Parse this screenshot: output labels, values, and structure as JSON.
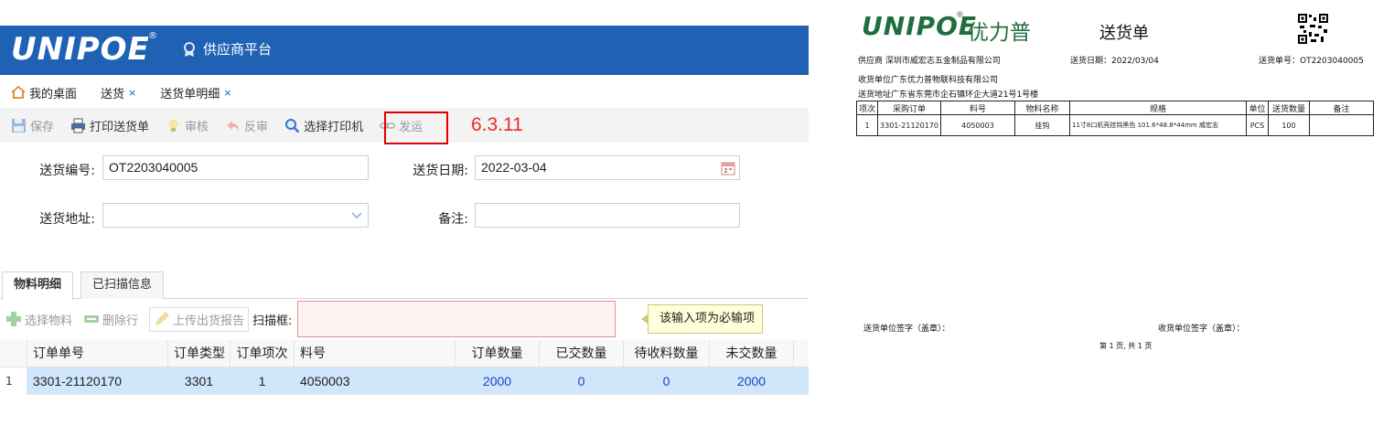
{
  "app": {
    "logo_text": "UNIPOE",
    "logo_reg": "®",
    "platform_name": "供应商平台",
    "tabs": [
      {
        "label": "我的桌面",
        "closable": false
      },
      {
        "label": "送货",
        "closable": true
      },
      {
        "label": "送货单明细",
        "closable": true
      }
    ],
    "tab_close": "×",
    "toolbar": {
      "save": "保存",
      "print": "打印送货单",
      "audit": "审核",
      "unaudit": "反审",
      "select_printer": "选择打印机",
      "send": "发运"
    },
    "version_annotation": "6.3.11",
    "form": {
      "delivery_no_label": "送货编号:",
      "delivery_no_value": "OT2203040005",
      "delivery_date_label": "送货日期:",
      "delivery_date_value": "2022-03-04",
      "address_label": "送货地址:",
      "address_value": "",
      "remark_label": "备注:",
      "remark_value": ""
    },
    "subtabs": {
      "materials": "物料明细",
      "scanned": "已扫描信息"
    },
    "subtoolbar": {
      "select_material": "选择物料",
      "delete_row": "删除行",
      "upload_report": "上传出货报告",
      "scan_label": "扫描框:",
      "required_tip": "该输入项为必输项"
    },
    "grid": {
      "columns": [
        "订单单号",
        "订单类型",
        "订单项次",
        "料号",
        "订单数量",
        "已交数量",
        "待收料数量",
        "未交数量"
      ],
      "rows": [
        {
          "index": "1",
          "cells": [
            "3301-21120170",
            "3301",
            "1",
            "4050003",
            "2000",
            "0",
            "0",
            "2000"
          ]
        }
      ]
    }
  },
  "delivery_note": {
    "logo_text": "UNIPOE",
    "logo_reg": "®",
    "logo_cn": "优力普",
    "title": "送货单",
    "supplier": "供应商 深圳市威宏志五金制品有限公司",
    "delivery_date": "送货日期：2022/03/04",
    "delivery_no": "送货单号：OT2203040005",
    "receiver": "收货单位广东优力普物联科技有限公司",
    "address": "送货地址广东省东莞市企石镇环企大道21号1号楼",
    "table": {
      "headers": [
        "项次",
        "采购订单",
        "料号",
        "物料名称",
        "规格",
        "单位",
        "送货数量",
        "备注"
      ],
      "rows": [
        [
          "1",
          "3301-21120170",
          "4050003",
          "挂钩",
          "11寸8口机壳挂钩黑色  101.6*48.8*44mm 威宏志",
          "PCS",
          "100",
          ""
        ]
      ]
    },
    "sign_sender": "送货单位签字（盖章）：",
    "sign_receiver": "收货单位签字（盖章）：",
    "page_info": "第 1 页, 共 1 页"
  },
  "colors": {
    "header_blue": "#1f62b3",
    "annotation_red": "#e52e2e",
    "grid_number_blue": "#1f3fc8",
    "selected_row": "#cfe6fb",
    "logo_green": "#1f6e3e"
  }
}
